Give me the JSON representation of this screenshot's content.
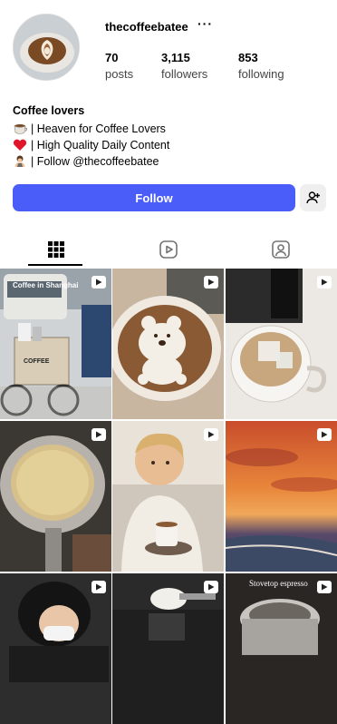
{
  "profile": {
    "username": "thecoffeebatee",
    "more_icon": "···",
    "stats": [
      {
        "value": "70",
        "label": "posts"
      },
      {
        "value": "3,115",
        "label": "followers"
      },
      {
        "value": "853",
        "label": "following"
      }
    ]
  },
  "bio": {
    "name": "Coffee lovers",
    "lines": [
      {
        "icon": "coffee-cup-icon",
        "text": "| Heaven for Coffee Lovers"
      },
      {
        "icon": "heart-icon",
        "text": "| High Quality Daily Content"
      },
      {
        "icon": "bowing-person-icon",
        "text": "| Follow @thecoffeebatee"
      }
    ]
  },
  "actions": {
    "follow_label": "Follow",
    "suggest_icon": "add-person-icon"
  },
  "tabs": [
    {
      "name": "posts-grid",
      "icon": "grid-icon",
      "active": true
    },
    {
      "name": "reels",
      "icon": "reels-icon",
      "active": false
    },
    {
      "name": "tagged",
      "icon": "tagged-icon",
      "active": false
    }
  ],
  "posts": [
    {
      "caption": "Coffee in Shanghai",
      "badge": "reel-icon"
    },
    {
      "caption": "",
      "badge": "reel-icon"
    },
    {
      "caption": "",
      "badge": "reel-icon"
    },
    {
      "caption": "",
      "badge": "reel-icon"
    },
    {
      "caption": "",
      "badge": "reel-icon"
    },
    {
      "caption": "",
      "badge": "reel-icon"
    },
    {
      "caption": "",
      "badge": "reel-icon"
    },
    {
      "caption": "",
      "badge": "reel-icon"
    },
    {
      "caption": "Stovetop espresso",
      "badge": "reel-icon"
    }
  ],
  "cart_sign_text": "COFFEE",
  "colors": {
    "follow_button": "#4a5df9",
    "tab_underline": "#000000"
  }
}
